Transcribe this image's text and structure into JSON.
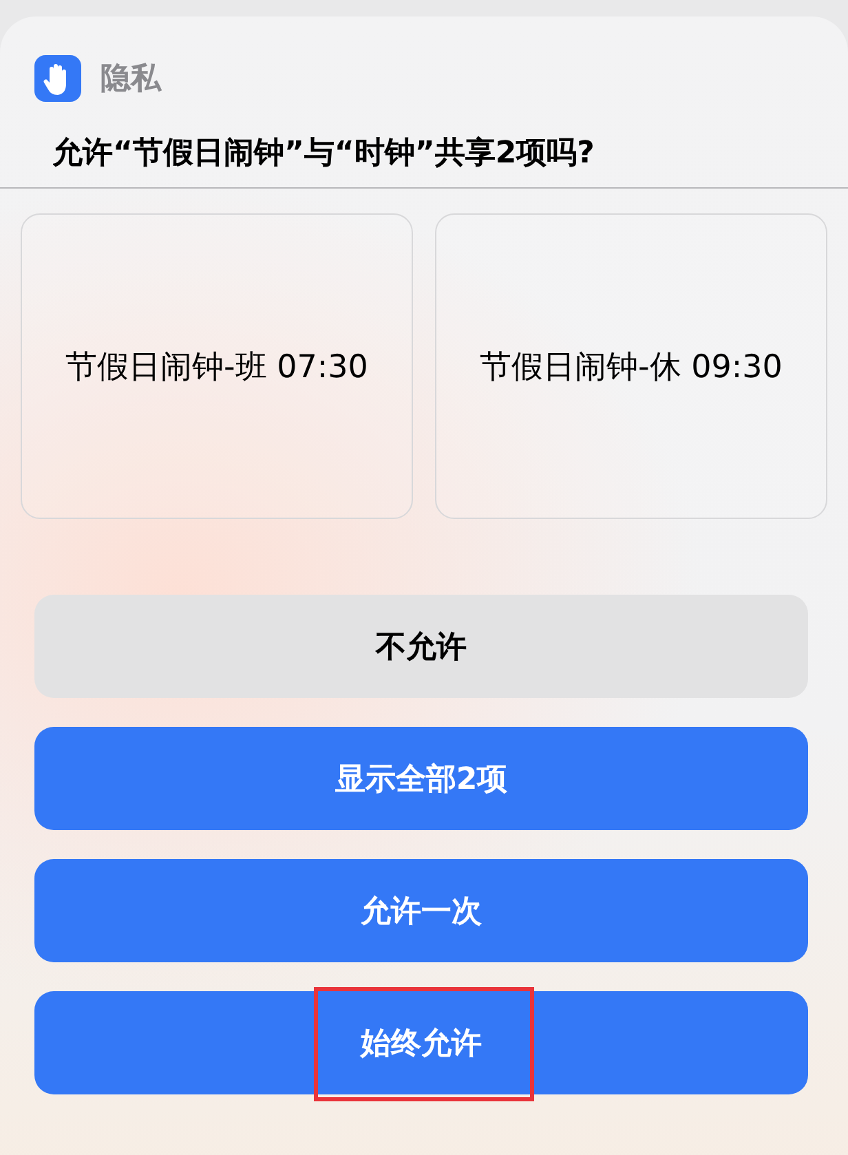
{
  "header": {
    "app_name": "隐私"
  },
  "question": "允许“节假日闹钟”与“时钟”共享2项吗?",
  "items": [
    {
      "label": "节假日闹钟-班 07:30"
    },
    {
      "label": "节假日闹钟-休 09:30"
    }
  ],
  "buttons": [
    {
      "label": "不允许",
      "kind": "secondary",
      "highlighted": false
    },
    {
      "label": "显示全部2项",
      "kind": "primary",
      "highlighted": false
    },
    {
      "label": "允许一次",
      "kind": "primary",
      "highlighted": false
    },
    {
      "label": "始终允许",
      "kind": "primary",
      "highlighted": true
    }
  ]
}
